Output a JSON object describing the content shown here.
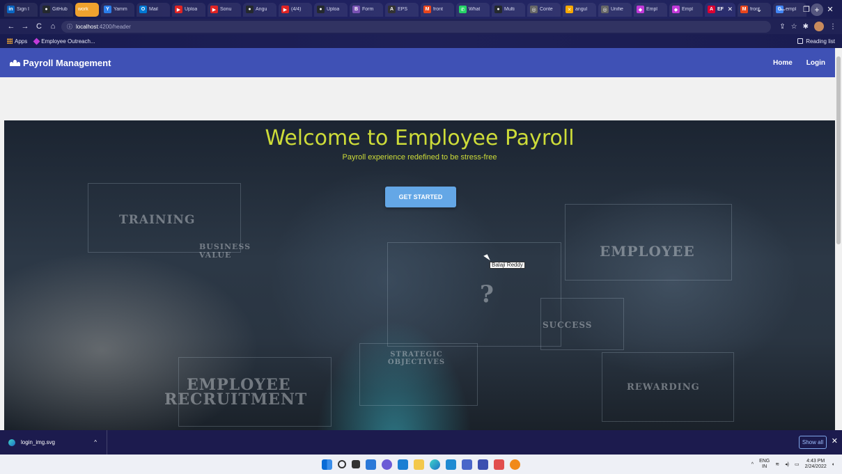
{
  "browser": {
    "tabs": [
      {
        "label": "Sign I",
        "fav_color": "#0a66c2",
        "fav_glyph": "in"
      },
      {
        "label": "GitHub",
        "fav_color": "#24292e",
        "fav_glyph": "●"
      },
      {
        "label": "work",
        "group": true
      },
      {
        "label": "Yamm",
        "fav_color": "#2b7de9",
        "fav_glyph": "Y"
      },
      {
        "label": "Mail",
        "fav_color": "#0078d4",
        "fav_glyph": "O"
      },
      {
        "label": "Uploa",
        "fav_color": "#e02424",
        "fav_glyph": "▶"
      },
      {
        "label": "Sonu",
        "fav_color": "#e02424",
        "fav_glyph": "▶"
      },
      {
        "label": "Angu",
        "fav_color": "#24292e",
        "fav_glyph": "●"
      },
      {
        "label": "(4/4)",
        "fav_color": "#e02424",
        "fav_glyph": "▶"
      },
      {
        "label": "Uploa",
        "fav_color": "#24292e",
        "fav_glyph": "●"
      },
      {
        "label": "Form",
        "fav_color": "#7952b3",
        "fav_glyph": "B"
      },
      {
        "label": "EPS",
        "fav_color": "#333333",
        "fav_glyph": "A"
      },
      {
        "label": "front",
        "fav_color": "#e8461d",
        "fav_glyph": "M"
      },
      {
        "label": "What",
        "fav_color": "#25d366",
        "fav_glyph": "✆"
      },
      {
        "label": "Multi",
        "fav_color": "#24292e",
        "fav_glyph": "●"
      },
      {
        "label": "Conte",
        "fav_color": "#666666",
        "fav_glyph": "◎"
      },
      {
        "label": "angul",
        "fav_color": "#f7a800",
        "fav_glyph": "✕"
      },
      {
        "label": "Unifie",
        "fav_color": "#666666",
        "fav_glyph": "◎"
      },
      {
        "label": "Empl",
        "fav_color": "#c23ad9",
        "fav_glyph": "◆"
      },
      {
        "label": "Empl",
        "fav_color": "#c23ad9",
        "fav_glyph": "◆"
      },
      {
        "label": "EF",
        "active": true,
        "fav_color": "#dd0031",
        "fav_glyph": "A"
      },
      {
        "label": "front",
        "fav_color": "#e8461d",
        "fav_glyph": "M"
      },
      {
        "label": "empl",
        "fav_color": "#4285f4",
        "fav_glyph": "G"
      }
    ],
    "url_host": "localhost",
    "url_path": ":4200/header",
    "bookmarks": {
      "apps": "Apps",
      "employee_outreach": "Employee Outreach...",
      "reading_list": "Reading list"
    }
  },
  "app": {
    "brand": "Payroll Management",
    "nav": {
      "home": "Home",
      "login": "Login"
    }
  },
  "hero": {
    "title": "Welcome to Employee Payroll",
    "subtitle": "Payroll experience redefined to be stress-free",
    "cta": "GET STARTED",
    "image_words": {
      "training": "TRAINING",
      "business": "BUSINESS VALUE",
      "employee": "EMPLOYEE",
      "question": "?",
      "success": "SUCCESS",
      "recruitment_1": "EMPLOYEE",
      "recruitment_2": "RECRUITMENT",
      "strategic": "STRATEGIC OBJECTIVES",
      "rewarding": "REWARDING"
    },
    "tooltip": "Balaji Reddy"
  },
  "downloads": {
    "file": "login_img.svg",
    "show_all": "Show all"
  },
  "taskbar": {
    "lang_1": "ENG",
    "lang_2": "IN",
    "time": "4:43 PM",
    "date": "2/24/2022"
  },
  "colors": {
    "app_bar": "#3f51b5",
    "hero_text": "#cddc39",
    "cta": "#64a7e6"
  }
}
